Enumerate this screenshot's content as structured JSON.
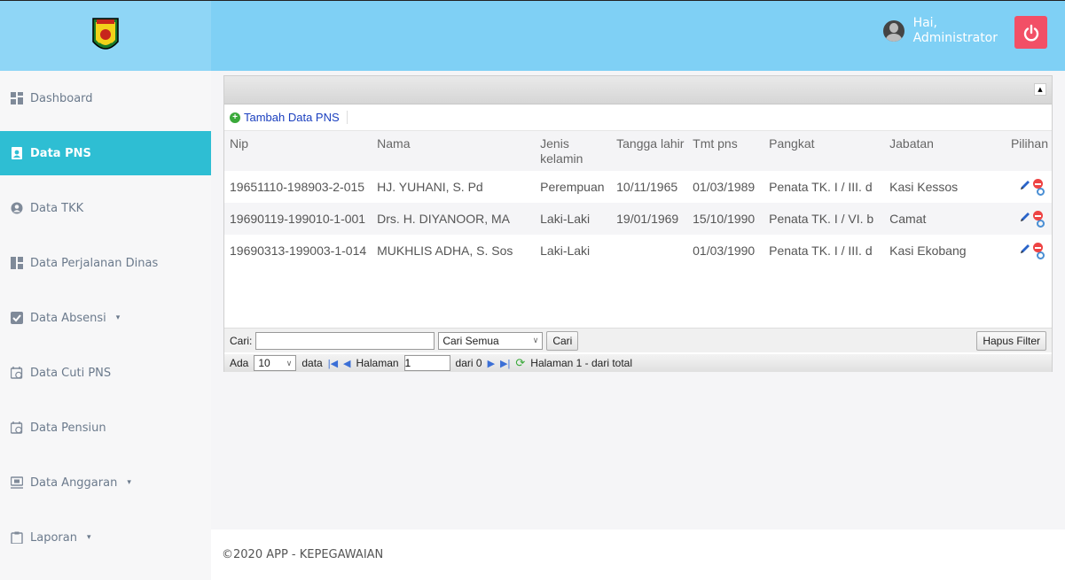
{
  "header": {
    "greeting_line1": "Hai,",
    "greeting_line2": "Administrator",
    "logo_icon": "regional-crest-logo",
    "power_icon": "power-icon",
    "colors": {
      "topbar": "#7fd0f5",
      "power": "#f24f66",
      "active": "#2ebed3"
    }
  },
  "sidebar": {
    "items": [
      {
        "label": "Dashboard",
        "icon": "dashboard-icon"
      },
      {
        "label": "Data PNS",
        "icon": "id-badge-icon",
        "active": true
      },
      {
        "label": "Data TKK",
        "icon": "user-circle-icon"
      },
      {
        "label": "Data Perjalanan Dinas",
        "icon": "columns-icon"
      },
      {
        "label": "Data Absensi",
        "icon": "checkbox-icon",
        "dropdown": true
      },
      {
        "label": "Data Cuti PNS",
        "icon": "calendar-clock-icon"
      },
      {
        "label": "Data Pensiun",
        "icon": "calendar-clock-icon"
      },
      {
        "label": "Data Anggaran",
        "icon": "projector-icon",
        "dropdown": true
      },
      {
        "label": "Laporan",
        "icon": "clipboard-icon",
        "dropdown": true
      }
    ]
  },
  "grid": {
    "add_label": "Tambah Data PNS",
    "columns": [
      "Nip",
      "Nama",
      "Jenis kelamin",
      "Tangga lahir",
      "Tmt pns",
      "Pangkat",
      "Jabatan",
      "Pilihan"
    ],
    "rows": [
      {
        "nip": "19651110-198903-2-015",
        "nama": "HJ. YUHANI, S. Pd",
        "jk": "Perempuan",
        "lahir": "10/11/1965",
        "tmt": "01/03/1989",
        "pangkat": "Penata TK. I / III. d",
        "jabatan": "Kasi Kessos"
      },
      {
        "nip": "19690119-199010-1-001",
        "nama": "Drs. H. DIYANOOR, MA",
        "jk": "Laki-Laki",
        "lahir": "19/01/1969",
        "tmt": "15/10/1990",
        "pangkat": "Penata TK. I / VI. b",
        "jabatan": "Camat"
      },
      {
        "nip": "19690313-199003-1-014",
        "nama": "MUKHLIS ADHA, S. Sos",
        "jk": "Laki-Laki",
        "lahir": "",
        "tmt": "01/03/1990",
        "pangkat": "Penata TK. I / III. d",
        "jabatan": "Kasi Ekobang"
      }
    ]
  },
  "search": {
    "label": "Cari:",
    "value": "",
    "scope_selected": "Cari Semua",
    "search_button": "Cari",
    "clear_button": "Hapus Filter"
  },
  "pager": {
    "prefix": "Ada",
    "page_size": "10",
    "suffix": "data",
    "page_label": "Halaman",
    "page_value": "1",
    "of_label": "dari 0",
    "status": "Halaman 1 - dari total"
  },
  "footer": {
    "text": "©2020 APP - KEPEGAWAIAN"
  }
}
